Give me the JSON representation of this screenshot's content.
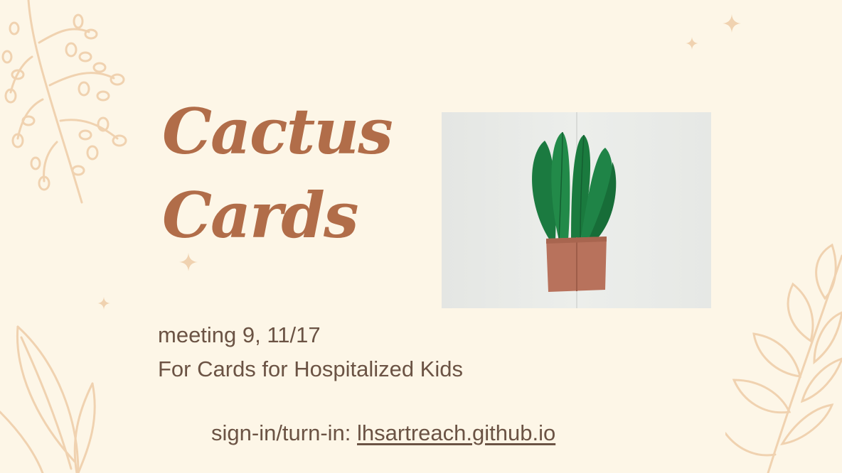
{
  "slide": {
    "title_line1": "Cactus",
    "title_line2": "Cards",
    "meeting": "meeting 9, 11/17",
    "organization": "For Cards for Hospitalized Kids",
    "signin_label": "sign-in/turn-in: ",
    "signin_link": "lhsartreach.github.io"
  },
  "colors": {
    "background": "#fdf6e7",
    "title": "#b16d49",
    "text": "#6b5344",
    "decoration": "#f0d2b0",
    "cactus_green": "#1f8447",
    "pot": "#b8725c"
  },
  "icons": [
    "sparkle-icon",
    "branch-decoration",
    "leaf-decoration"
  ]
}
